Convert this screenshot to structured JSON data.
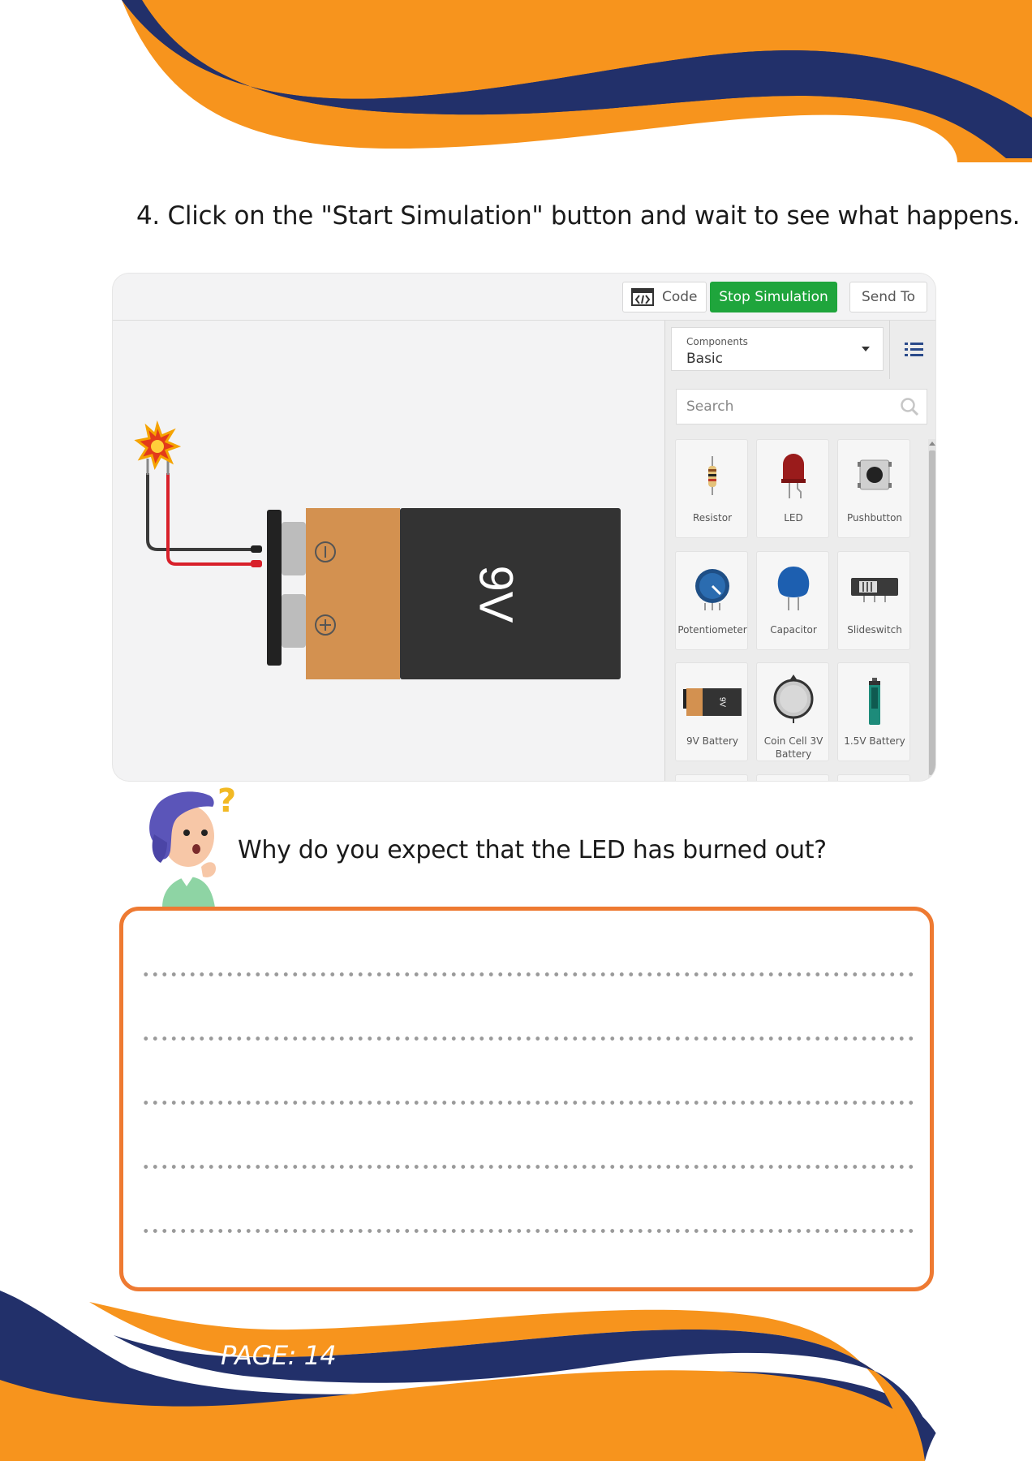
{
  "instruction": "4. Click on the \"Start Simulation\" button and wait to see what happens.",
  "toolbar": {
    "code_label": "Code",
    "stop_label": "Stop Simulation",
    "send_label": "Send To"
  },
  "battery_label": "9V",
  "panel": {
    "dropdown_caption": "Components",
    "dropdown_value": "Basic",
    "search_placeholder": "Search",
    "components": [
      {
        "label": "Resistor",
        "icon": "resistor-icon"
      },
      {
        "label": "LED",
        "icon": "led-icon"
      },
      {
        "label": "Pushbutton",
        "icon": "pushbutton-icon"
      },
      {
        "label": "Potentiometer",
        "icon": "potentiometer-icon"
      },
      {
        "label": "Capacitor",
        "icon": "capacitor-icon"
      },
      {
        "label": "Slideswitch",
        "icon": "slideswitch-icon"
      },
      {
        "label": "9V Battery",
        "icon": "9v-battery-icon"
      },
      {
        "label": "Coin Cell 3V",
        "label2": "Battery",
        "icon": "coin-cell-battery-icon"
      },
      {
        "label": "1.5V Battery",
        "icon": "1-5v-battery-icon"
      }
    ]
  },
  "question": "Why do you expect that the LED has burned out?",
  "question_mark": "?",
  "answer_line_count": 5,
  "page_label": "PAGE: 14",
  "colors": {
    "orange": "#f7941d",
    "navy": "#22306a",
    "green_button": "#1fa53c",
    "box_border": "#ee7a32"
  }
}
